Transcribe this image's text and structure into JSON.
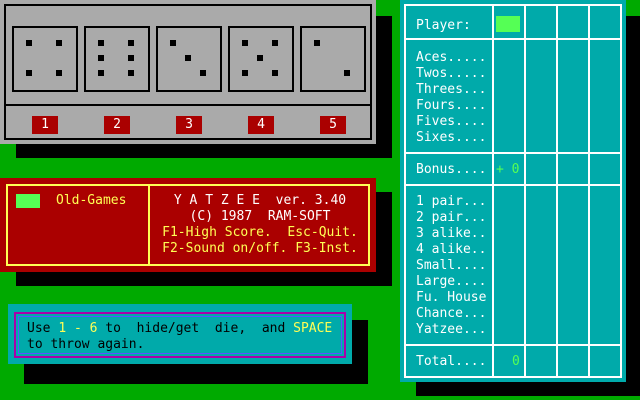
{
  "colors": {
    "background": "#00aa00",
    "tray": "#aaaaaa",
    "red": "#aa0000",
    "cyan": "#00aaaa",
    "yellow": "#ffff55",
    "light_green": "#55ff55",
    "magenta": "#aa00aa"
  },
  "dice": [
    {
      "number": "1",
      "face": 4
    },
    {
      "number": "2",
      "face": 6
    },
    {
      "number": "3",
      "face": 3
    },
    {
      "number": "4",
      "face": 5
    },
    {
      "number": "5",
      "face": 2
    }
  ],
  "title_box": {
    "menu_item": "Old-Games",
    "line1": "Y A T Z E E  ver. 3.40",
    "line2": "(C) 1987  RAM-SOFT",
    "line3": "F1-High Score.  Esc-Quit.",
    "line4": "F2-Sound on/off. F3-Inst."
  },
  "instructions": {
    "l1_a": "Use ",
    "l1_b": "1 - 6",
    "l1_c": " to  hide/get  die,  and ",
    "l1_d": "SPACE",
    "l2": "to throw again."
  },
  "scorecard": {
    "player_label": "Player:",
    "upper": [
      "Aces.....",
      "Twos.....",
      "Threes...",
      "Fours....",
      "Fives....",
      "Sixes...."
    ],
    "bonus_label": "Bonus....",
    "bonus_value": "+ 0",
    "lower": [
      "1 pair...",
      "2 pair...",
      "3 alike..",
      "4 alike..",
      "Small....",
      "Large....",
      "Fu. House",
      "Chance...",
      "Yatzee..."
    ],
    "total_label": "Total....",
    "total_value": "0"
  }
}
